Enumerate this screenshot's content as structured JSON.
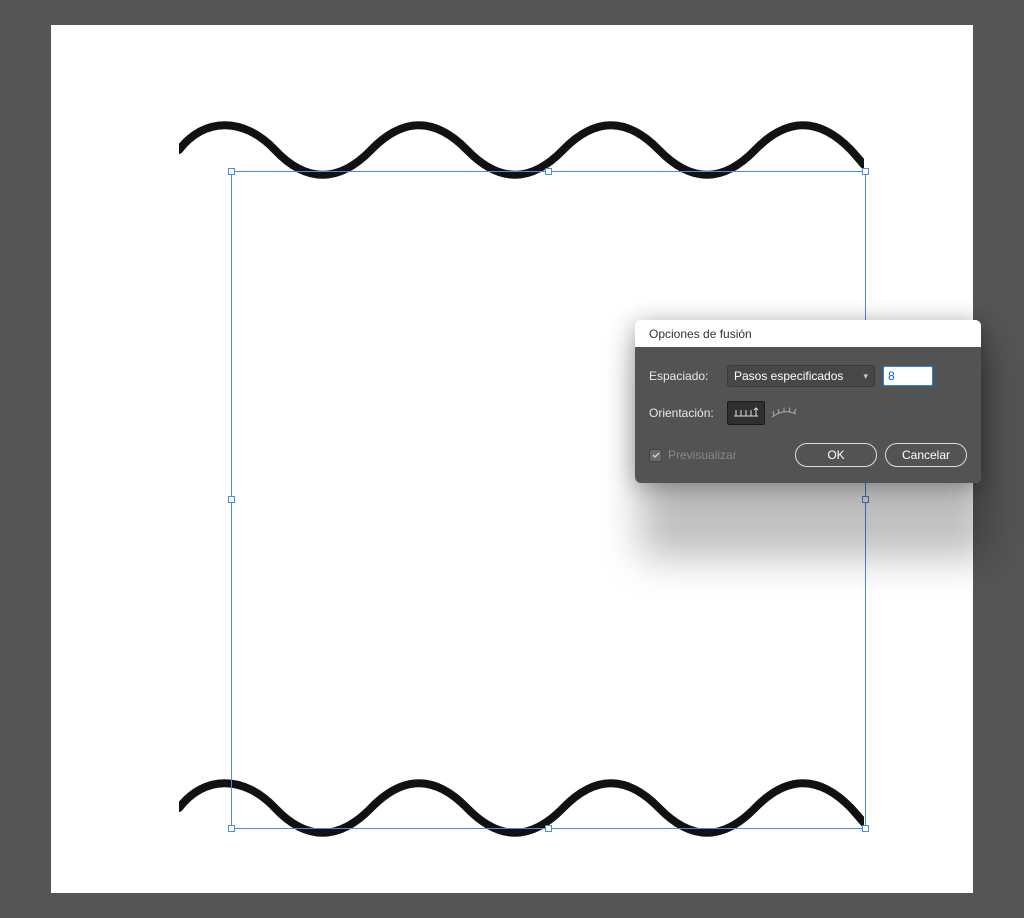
{
  "dialog": {
    "title": "Opciones de fusión",
    "spacing_label": "Espaciado:",
    "spacing_select": "Pasos especificados",
    "spacing_value": "8",
    "orientation_label": "Orientación:",
    "preview_label": "Previsualizar",
    "ok_label": "OK",
    "cancel_label": "Cancelar"
  },
  "canvas": {
    "wave_stroke_width": 8
  }
}
